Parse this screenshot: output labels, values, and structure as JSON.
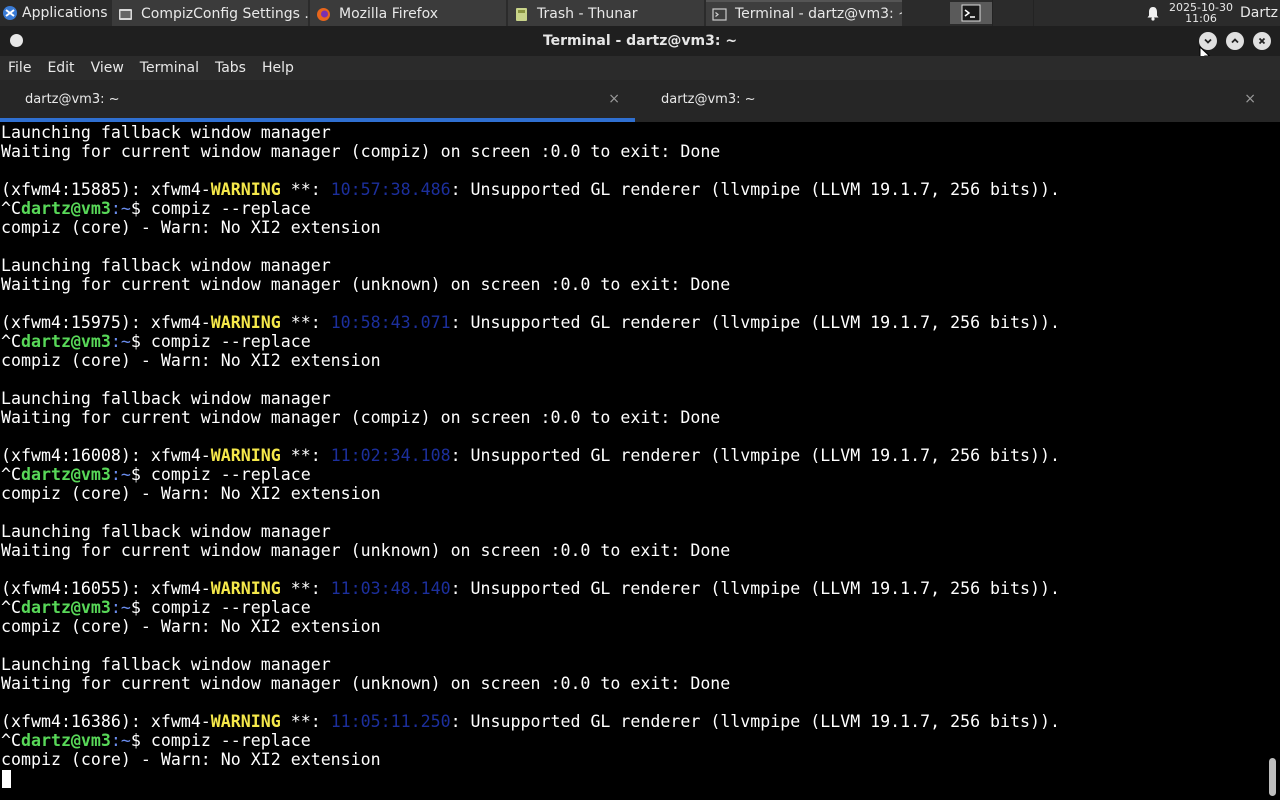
{
  "panel": {
    "apps_label": "Applications",
    "tasks": [
      {
        "label": "CompizConfig Settings ...",
        "icon": "settings-icon",
        "active": false
      },
      {
        "label": "Mozilla Firefox",
        "icon": "firefox-icon",
        "active": false
      },
      {
        "label": "Trash - Thunar",
        "icon": "file-manager-icon",
        "active": false
      },
      {
        "label": "Terminal - dartz@vm3: ~",
        "icon": "terminal-icon",
        "active": true
      }
    ],
    "clock_date": "2025-10-30",
    "clock_time": "11:06",
    "user": "Dartz"
  },
  "window": {
    "title": "Terminal - dartz@vm3: ~"
  },
  "menu": {
    "items": [
      "File",
      "Edit",
      "View",
      "Terminal",
      "Tabs",
      "Help"
    ]
  },
  "tabs": [
    {
      "label": "dartz@vm3: ~",
      "close": "×",
      "active": true
    },
    {
      "label": "dartz@vm3: ~",
      "close": "×",
      "active": false
    }
  ],
  "terminal": {
    "lines": [
      {
        "type": "plain",
        "text": "Launching fallback window manager"
      },
      {
        "type": "plain",
        "text": "Waiting for current window manager (compiz) on screen :0.0 to exit: Done"
      },
      {
        "type": "plain",
        "text": ""
      },
      {
        "type": "warning",
        "pid": "(xfwm4:15885): xfwm4-",
        "level": "WARNING",
        "sep": " **: ",
        "time": "10:57:38.486",
        "msg": ": Unsupported GL renderer (llvmpipe (LLVM 19.1.7, 256 bits))."
      },
      {
        "type": "prompt",
        "pre": "^C",
        "user": "dartz@vm3",
        "path": ":~",
        "cmd": "$ compiz --replace"
      },
      {
        "type": "plain",
        "text": "compiz (core) - Warn: No XI2 extension"
      },
      {
        "type": "plain",
        "text": ""
      },
      {
        "type": "plain",
        "text": "Launching fallback window manager"
      },
      {
        "type": "plain",
        "text": "Waiting for current window manager (unknown) on screen :0.0 to exit: Done"
      },
      {
        "type": "plain",
        "text": ""
      },
      {
        "type": "warning",
        "pid": "(xfwm4:15975): xfwm4-",
        "level": "WARNING",
        "sep": " **: ",
        "time": "10:58:43.071",
        "msg": ": Unsupported GL renderer (llvmpipe (LLVM 19.1.7, 256 bits))."
      },
      {
        "type": "prompt",
        "pre": "^C",
        "user": "dartz@vm3",
        "path": ":~",
        "cmd": "$ compiz --replace"
      },
      {
        "type": "plain",
        "text": "compiz (core) - Warn: No XI2 extension"
      },
      {
        "type": "plain",
        "text": ""
      },
      {
        "type": "plain",
        "text": "Launching fallback window manager"
      },
      {
        "type": "plain",
        "text": "Waiting for current window manager (compiz) on screen :0.0 to exit: Done"
      },
      {
        "type": "plain",
        "text": ""
      },
      {
        "type": "warning",
        "pid": "(xfwm4:16008): xfwm4-",
        "level": "WARNING",
        "sep": " **: ",
        "time": "11:02:34.108",
        "msg": ": Unsupported GL renderer (llvmpipe (LLVM 19.1.7, 256 bits))."
      },
      {
        "type": "prompt",
        "pre": "^C",
        "user": "dartz@vm3",
        "path": ":~",
        "cmd": "$ compiz --replace"
      },
      {
        "type": "plain",
        "text": "compiz (core) - Warn: No XI2 extension"
      },
      {
        "type": "plain",
        "text": ""
      },
      {
        "type": "plain",
        "text": "Launching fallback window manager"
      },
      {
        "type": "plain",
        "text": "Waiting for current window manager (unknown) on screen :0.0 to exit: Done"
      },
      {
        "type": "plain",
        "text": ""
      },
      {
        "type": "warning",
        "pid": "(xfwm4:16055): xfwm4-",
        "level": "WARNING",
        "sep": " **: ",
        "time": "11:03:48.140",
        "msg": ": Unsupported GL renderer (llvmpipe (LLVM 19.1.7, 256 bits))."
      },
      {
        "type": "prompt",
        "pre": "^C",
        "user": "dartz@vm3",
        "path": ":~",
        "cmd": "$ compiz --replace"
      },
      {
        "type": "plain",
        "text": "compiz (core) - Warn: No XI2 extension"
      },
      {
        "type": "plain",
        "text": ""
      },
      {
        "type": "plain",
        "text": "Launching fallback window manager"
      },
      {
        "type": "plain",
        "text": "Waiting for current window manager (unknown) on screen :0.0 to exit: Done"
      },
      {
        "type": "plain",
        "text": ""
      },
      {
        "type": "warning",
        "pid": "(xfwm4:16386): xfwm4-",
        "level": "WARNING",
        "sep": " **: ",
        "time": "11:05:11.250",
        "msg": ": Unsupported GL renderer (llvmpipe (LLVM 19.1.7, 256 bits))."
      },
      {
        "type": "prompt",
        "pre": "^C",
        "user": "dartz@vm3",
        "path": ":~",
        "cmd": "$ compiz --replace"
      },
      {
        "type": "plain",
        "text": "compiz (core) - Warn: No XI2 extension"
      }
    ]
  },
  "colors": {
    "warning": "#f5e84a",
    "timestamp": "#1c2f9c",
    "prompt_user": "#58d858",
    "prompt_path": "#6b8ef0",
    "tab_indicator": "#2f6fd0"
  }
}
